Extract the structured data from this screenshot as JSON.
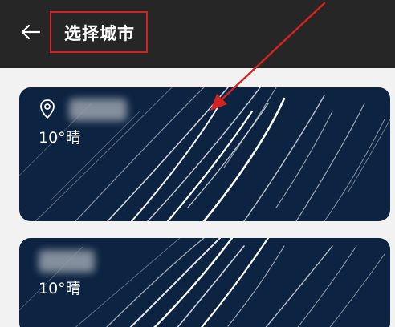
{
  "header": {
    "title": "选择城市",
    "back_icon": "arrow-left-icon"
  },
  "cities": [
    {
      "temperature": "10°晴",
      "current_location": true,
      "location_icon": "location-pin-icon"
    },
    {
      "temperature": "10°晴",
      "current_location": false
    }
  ],
  "colors": {
    "appbar": "#262626",
    "background": "#f2f2f2",
    "card": "#0c2341",
    "annotation": "#d3221f"
  }
}
